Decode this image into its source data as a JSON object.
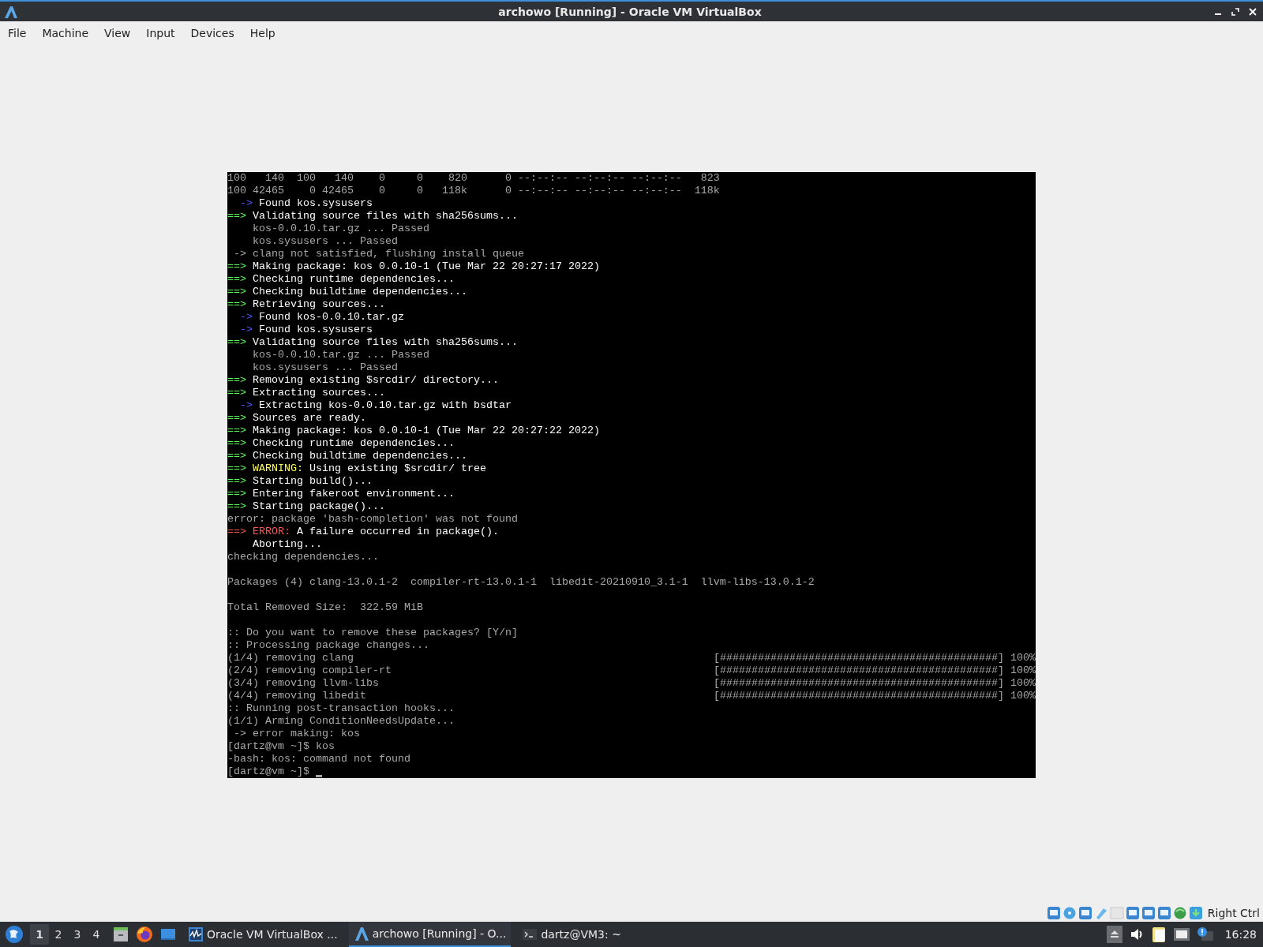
{
  "window": {
    "title": "archowo [Running] - Oracle VM VirtualBox"
  },
  "menu": [
    "File",
    "Machine",
    "View",
    "Input",
    "Devices",
    "Help"
  ],
  "terminal": {
    "lines": [
      {
        "segments": [
          {
            "kind": "plain",
            "text": "100   140  100   140    0     0    820      0 --:--:-- --:--:-- --:--:--   823"
          }
        ]
      },
      {
        "segments": [
          {
            "kind": "plain",
            "text": "100 42465    0 42465    0     0   118k      0 --:--:-- --:--:-- --:--:--  118k"
          }
        ]
      },
      {
        "segments": [
          {
            "kind": "blue",
            "text": "  ->"
          },
          {
            "kind": "bright",
            "text": " Found kos.sysusers"
          }
        ]
      },
      {
        "segments": [
          {
            "kind": "green",
            "text": "==>"
          },
          {
            "kind": "bright",
            "text": " Validating source files with sha256sums..."
          }
        ]
      },
      {
        "segments": [
          {
            "kind": "plain",
            "text": "    kos-0.0.10.tar.gz ... Passed"
          }
        ]
      },
      {
        "segments": [
          {
            "kind": "plain",
            "text": "    kos.sysusers ... Passed"
          }
        ]
      },
      {
        "segments": [
          {
            "kind": "plain",
            "text": " -> clang not satisfied, flushing install queue"
          }
        ]
      },
      {
        "segments": [
          {
            "kind": "green",
            "text": "==>"
          },
          {
            "kind": "bright",
            "text": " Making package: kos 0.0.10-1 (Tue Mar 22 20:27:17 2022)"
          }
        ]
      },
      {
        "segments": [
          {
            "kind": "green",
            "text": "==>"
          },
          {
            "kind": "bright",
            "text": " Checking runtime dependencies..."
          }
        ]
      },
      {
        "segments": [
          {
            "kind": "green",
            "text": "==>"
          },
          {
            "kind": "bright",
            "text": " Checking buildtime dependencies..."
          }
        ]
      },
      {
        "segments": [
          {
            "kind": "green",
            "text": "==>"
          },
          {
            "kind": "bright",
            "text": " Retrieving sources..."
          }
        ]
      },
      {
        "segments": [
          {
            "kind": "blue",
            "text": "  ->"
          },
          {
            "kind": "bright",
            "text": " Found kos-0.0.10.tar.gz"
          }
        ]
      },
      {
        "segments": [
          {
            "kind": "blue",
            "text": "  ->"
          },
          {
            "kind": "bright",
            "text": " Found kos.sysusers"
          }
        ]
      },
      {
        "segments": [
          {
            "kind": "green",
            "text": "==>"
          },
          {
            "kind": "bright",
            "text": " Validating source files with sha256sums..."
          }
        ]
      },
      {
        "segments": [
          {
            "kind": "plain",
            "text": "    kos-0.0.10.tar.gz ... Passed"
          }
        ]
      },
      {
        "segments": [
          {
            "kind": "plain",
            "text": "    kos.sysusers ... Passed"
          }
        ]
      },
      {
        "segments": [
          {
            "kind": "green",
            "text": "==>"
          },
          {
            "kind": "bright",
            "text": " Removing existing $srcdir/ directory..."
          }
        ]
      },
      {
        "segments": [
          {
            "kind": "green",
            "text": "==>"
          },
          {
            "kind": "bright",
            "text": " Extracting sources..."
          }
        ]
      },
      {
        "segments": [
          {
            "kind": "blue",
            "text": "  ->"
          },
          {
            "kind": "bright",
            "text": " Extracting kos-0.0.10.tar.gz with bsdtar"
          }
        ]
      },
      {
        "segments": [
          {
            "kind": "green",
            "text": "==>"
          },
          {
            "kind": "bright",
            "text": " Sources are ready."
          }
        ]
      },
      {
        "segments": [
          {
            "kind": "green",
            "text": "==>"
          },
          {
            "kind": "bright",
            "text": " Making package: kos 0.0.10-1 (Tue Mar 22 20:27:22 2022)"
          }
        ]
      },
      {
        "segments": [
          {
            "kind": "green",
            "text": "==>"
          },
          {
            "kind": "bright",
            "text": " Checking runtime dependencies..."
          }
        ]
      },
      {
        "segments": [
          {
            "kind": "green",
            "text": "==>"
          },
          {
            "kind": "bright",
            "text": " Checking buildtime dependencies..."
          }
        ]
      },
      {
        "segments": [
          {
            "kind": "green",
            "text": "==>"
          },
          {
            "kind": "yellow",
            "text": " WARNING:"
          },
          {
            "kind": "bright",
            "text": " Using existing $srcdir/ tree"
          }
        ]
      },
      {
        "segments": [
          {
            "kind": "green",
            "text": "==>"
          },
          {
            "kind": "bright",
            "text": " Starting build()..."
          }
        ]
      },
      {
        "segments": [
          {
            "kind": "green",
            "text": "==>"
          },
          {
            "kind": "bright",
            "text": " Entering fakeroot environment..."
          }
        ]
      },
      {
        "segments": [
          {
            "kind": "green",
            "text": "==>"
          },
          {
            "kind": "bright",
            "text": " Starting package()..."
          }
        ]
      },
      {
        "segments": [
          {
            "kind": "plain",
            "text": "error: package 'bash-completion' was not found"
          }
        ]
      },
      {
        "segments": [
          {
            "kind": "red",
            "text": "==> ERROR:"
          },
          {
            "kind": "bright",
            "text": " A failure occurred in package()."
          }
        ]
      },
      {
        "segments": [
          {
            "kind": "bright",
            "text": "    Aborting..."
          }
        ]
      },
      {
        "segments": [
          {
            "kind": "plain",
            "text": "checking dependencies..."
          }
        ]
      },
      {
        "kind": "blank"
      },
      {
        "segments": [
          {
            "kind": "plain",
            "text": "Packages (4) clang-13.0.1-2  compiler-rt-13.0.1-1  libedit-20210910_3.1-1  llvm-libs-13.0.1-2"
          }
        ]
      },
      {
        "kind": "blank"
      },
      {
        "segments": [
          {
            "kind": "plain",
            "text": "Total Removed Size:  322.59 MiB"
          }
        ]
      },
      {
        "kind": "blank"
      },
      {
        "segments": [
          {
            "kind": "plain",
            "text": ":: Do you want to remove these packages? [Y/n]"
          }
        ]
      },
      {
        "segments": [
          {
            "kind": "plain",
            "text": ":: Processing package changes..."
          }
        ]
      },
      {
        "kind": "progress",
        "label": "(1/4) removing clang",
        "bar": "[############################################]",
        "percent": "100%"
      },
      {
        "kind": "progress",
        "label": "(2/4) removing compiler-rt",
        "bar": "[############################################]",
        "percent": "100%"
      },
      {
        "kind": "progress",
        "label": "(3/4) removing llvm-libs",
        "bar": "[############################################]",
        "percent": "100%"
      },
      {
        "kind": "progress",
        "label": "(4/4) removing libedit",
        "bar": "[############################################]",
        "percent": "100%"
      },
      {
        "segments": [
          {
            "kind": "plain",
            "text": ":: Running post-transaction hooks..."
          }
        ]
      },
      {
        "segments": [
          {
            "kind": "plain",
            "text": "(1/1) Arming ConditionNeedsUpdate..."
          }
        ]
      },
      {
        "segments": [
          {
            "kind": "plain",
            "text": " -> error making: kos"
          }
        ]
      },
      {
        "segments": [
          {
            "kind": "plain",
            "text": "[dartz@vm ~]$ kos"
          }
        ]
      },
      {
        "segments": [
          {
            "kind": "plain",
            "text": "-bash: kos: command not found"
          }
        ]
      },
      {
        "segments": [
          {
            "kind": "plain",
            "text": "[dartz@vm ~]$ "
          }
        ],
        "cursor": true
      }
    ]
  },
  "status_bar": {
    "host_key": "Right Ctrl"
  },
  "taskbar": {
    "workspaces": [
      {
        "label": "1",
        "selected": true
      },
      {
        "label": "2",
        "selected": false
      },
      {
        "label": "3",
        "selected": false
      },
      {
        "label": "4",
        "selected": false
      }
    ],
    "tasks": [
      {
        "kind": "monitor",
        "label": "Oracle VM VirtualBox ...",
        "selected": false
      },
      {
        "kind": "virtualbox",
        "label": "archowo [Running] - O...",
        "selected": true
      },
      {
        "kind": "terminal",
        "label": "dartz@VM3: ~",
        "selected": false
      }
    ],
    "clock": "16:28"
  }
}
